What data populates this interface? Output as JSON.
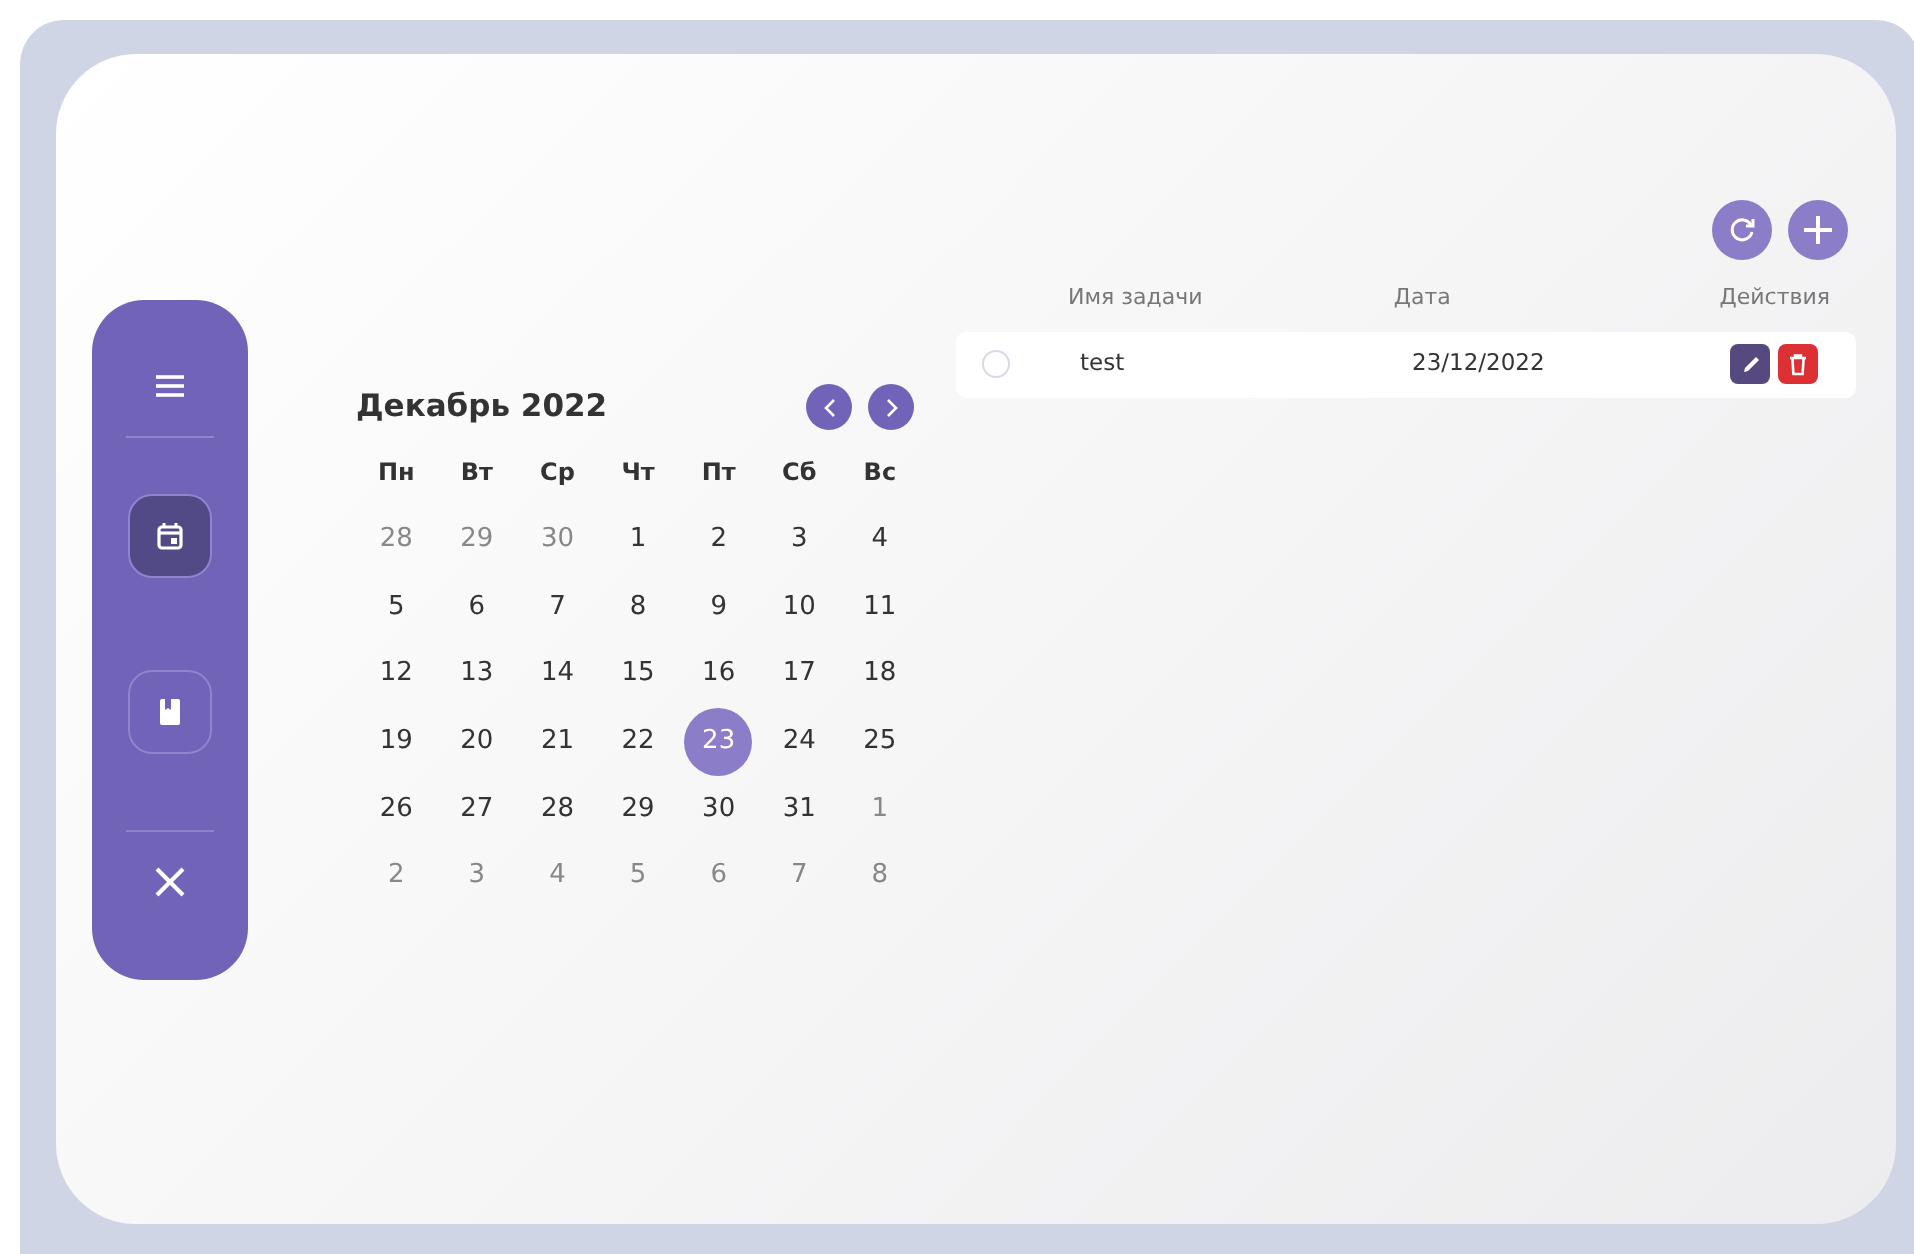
{
  "sidebar": {
    "items": [
      {
        "kind": "menu",
        "selected": false
      },
      {
        "kind": "calendar",
        "selected": true
      },
      {
        "kind": "notes",
        "selected": false
      },
      {
        "kind": "close",
        "selected": false
      }
    ]
  },
  "calendar": {
    "title": "Декабрь 2022",
    "weekdays": [
      "Пн",
      "Вт",
      "Ср",
      "Чт",
      "Пт",
      "Сб",
      "Вс"
    ],
    "weeks": [
      [
        {
          "day": "28",
          "muted": true,
          "selected": false
        },
        {
          "day": "29",
          "muted": true,
          "selected": false
        },
        {
          "day": "30",
          "muted": true,
          "selected": false
        },
        {
          "day": "1",
          "muted": false,
          "selected": false
        },
        {
          "day": "2",
          "muted": false,
          "selected": false
        },
        {
          "day": "3",
          "muted": false,
          "selected": false
        },
        {
          "day": "4",
          "muted": false,
          "selected": false
        }
      ],
      [
        {
          "day": "5",
          "muted": false,
          "selected": false
        },
        {
          "day": "6",
          "muted": false,
          "selected": false
        },
        {
          "day": "7",
          "muted": false,
          "selected": false
        },
        {
          "day": "8",
          "muted": false,
          "selected": false
        },
        {
          "day": "9",
          "muted": false,
          "selected": false
        },
        {
          "day": "10",
          "muted": false,
          "selected": false
        },
        {
          "day": "11",
          "muted": false,
          "selected": false
        }
      ],
      [
        {
          "day": "12",
          "muted": false,
          "selected": false
        },
        {
          "day": "13",
          "muted": false,
          "selected": false
        },
        {
          "day": "14",
          "muted": false,
          "selected": false
        },
        {
          "day": "15",
          "muted": false,
          "selected": false
        },
        {
          "day": "16",
          "muted": false,
          "selected": false
        },
        {
          "day": "17",
          "muted": false,
          "selected": false
        },
        {
          "day": "18",
          "muted": false,
          "selected": false
        }
      ],
      [
        {
          "day": "19",
          "muted": false,
          "selected": false
        },
        {
          "day": "20",
          "muted": false,
          "selected": false
        },
        {
          "day": "21",
          "muted": false,
          "selected": false
        },
        {
          "day": "22",
          "muted": false,
          "selected": false
        },
        {
          "day": "23",
          "muted": false,
          "selected": true
        },
        {
          "day": "24",
          "muted": false,
          "selected": false
        },
        {
          "day": "25",
          "muted": false,
          "selected": false
        }
      ],
      [
        {
          "day": "26",
          "muted": false,
          "selected": false
        },
        {
          "day": "27",
          "muted": false,
          "selected": false
        },
        {
          "day": "28",
          "muted": false,
          "selected": false
        },
        {
          "day": "29",
          "muted": false,
          "selected": false
        },
        {
          "day": "30",
          "muted": false,
          "selected": false
        },
        {
          "day": "31",
          "muted": false,
          "selected": false
        },
        {
          "day": "1",
          "muted": true,
          "selected": false
        }
      ],
      [
        {
          "day": "2",
          "muted": true,
          "selected": false
        },
        {
          "day": "3",
          "muted": true,
          "selected": false
        },
        {
          "day": "4",
          "muted": true,
          "selected": false
        },
        {
          "day": "5",
          "muted": true,
          "selected": false
        },
        {
          "day": "6",
          "muted": true,
          "selected": false
        },
        {
          "day": "7",
          "muted": true,
          "selected": false
        },
        {
          "day": "8",
          "muted": true,
          "selected": false
        }
      ]
    ]
  },
  "tasks": {
    "columns": [
      "Имя задачи",
      "Дата",
      "Действия"
    ],
    "rows": [
      {
        "done": false,
        "name": "test",
        "date": "23/12/2022"
      }
    ]
  }
}
